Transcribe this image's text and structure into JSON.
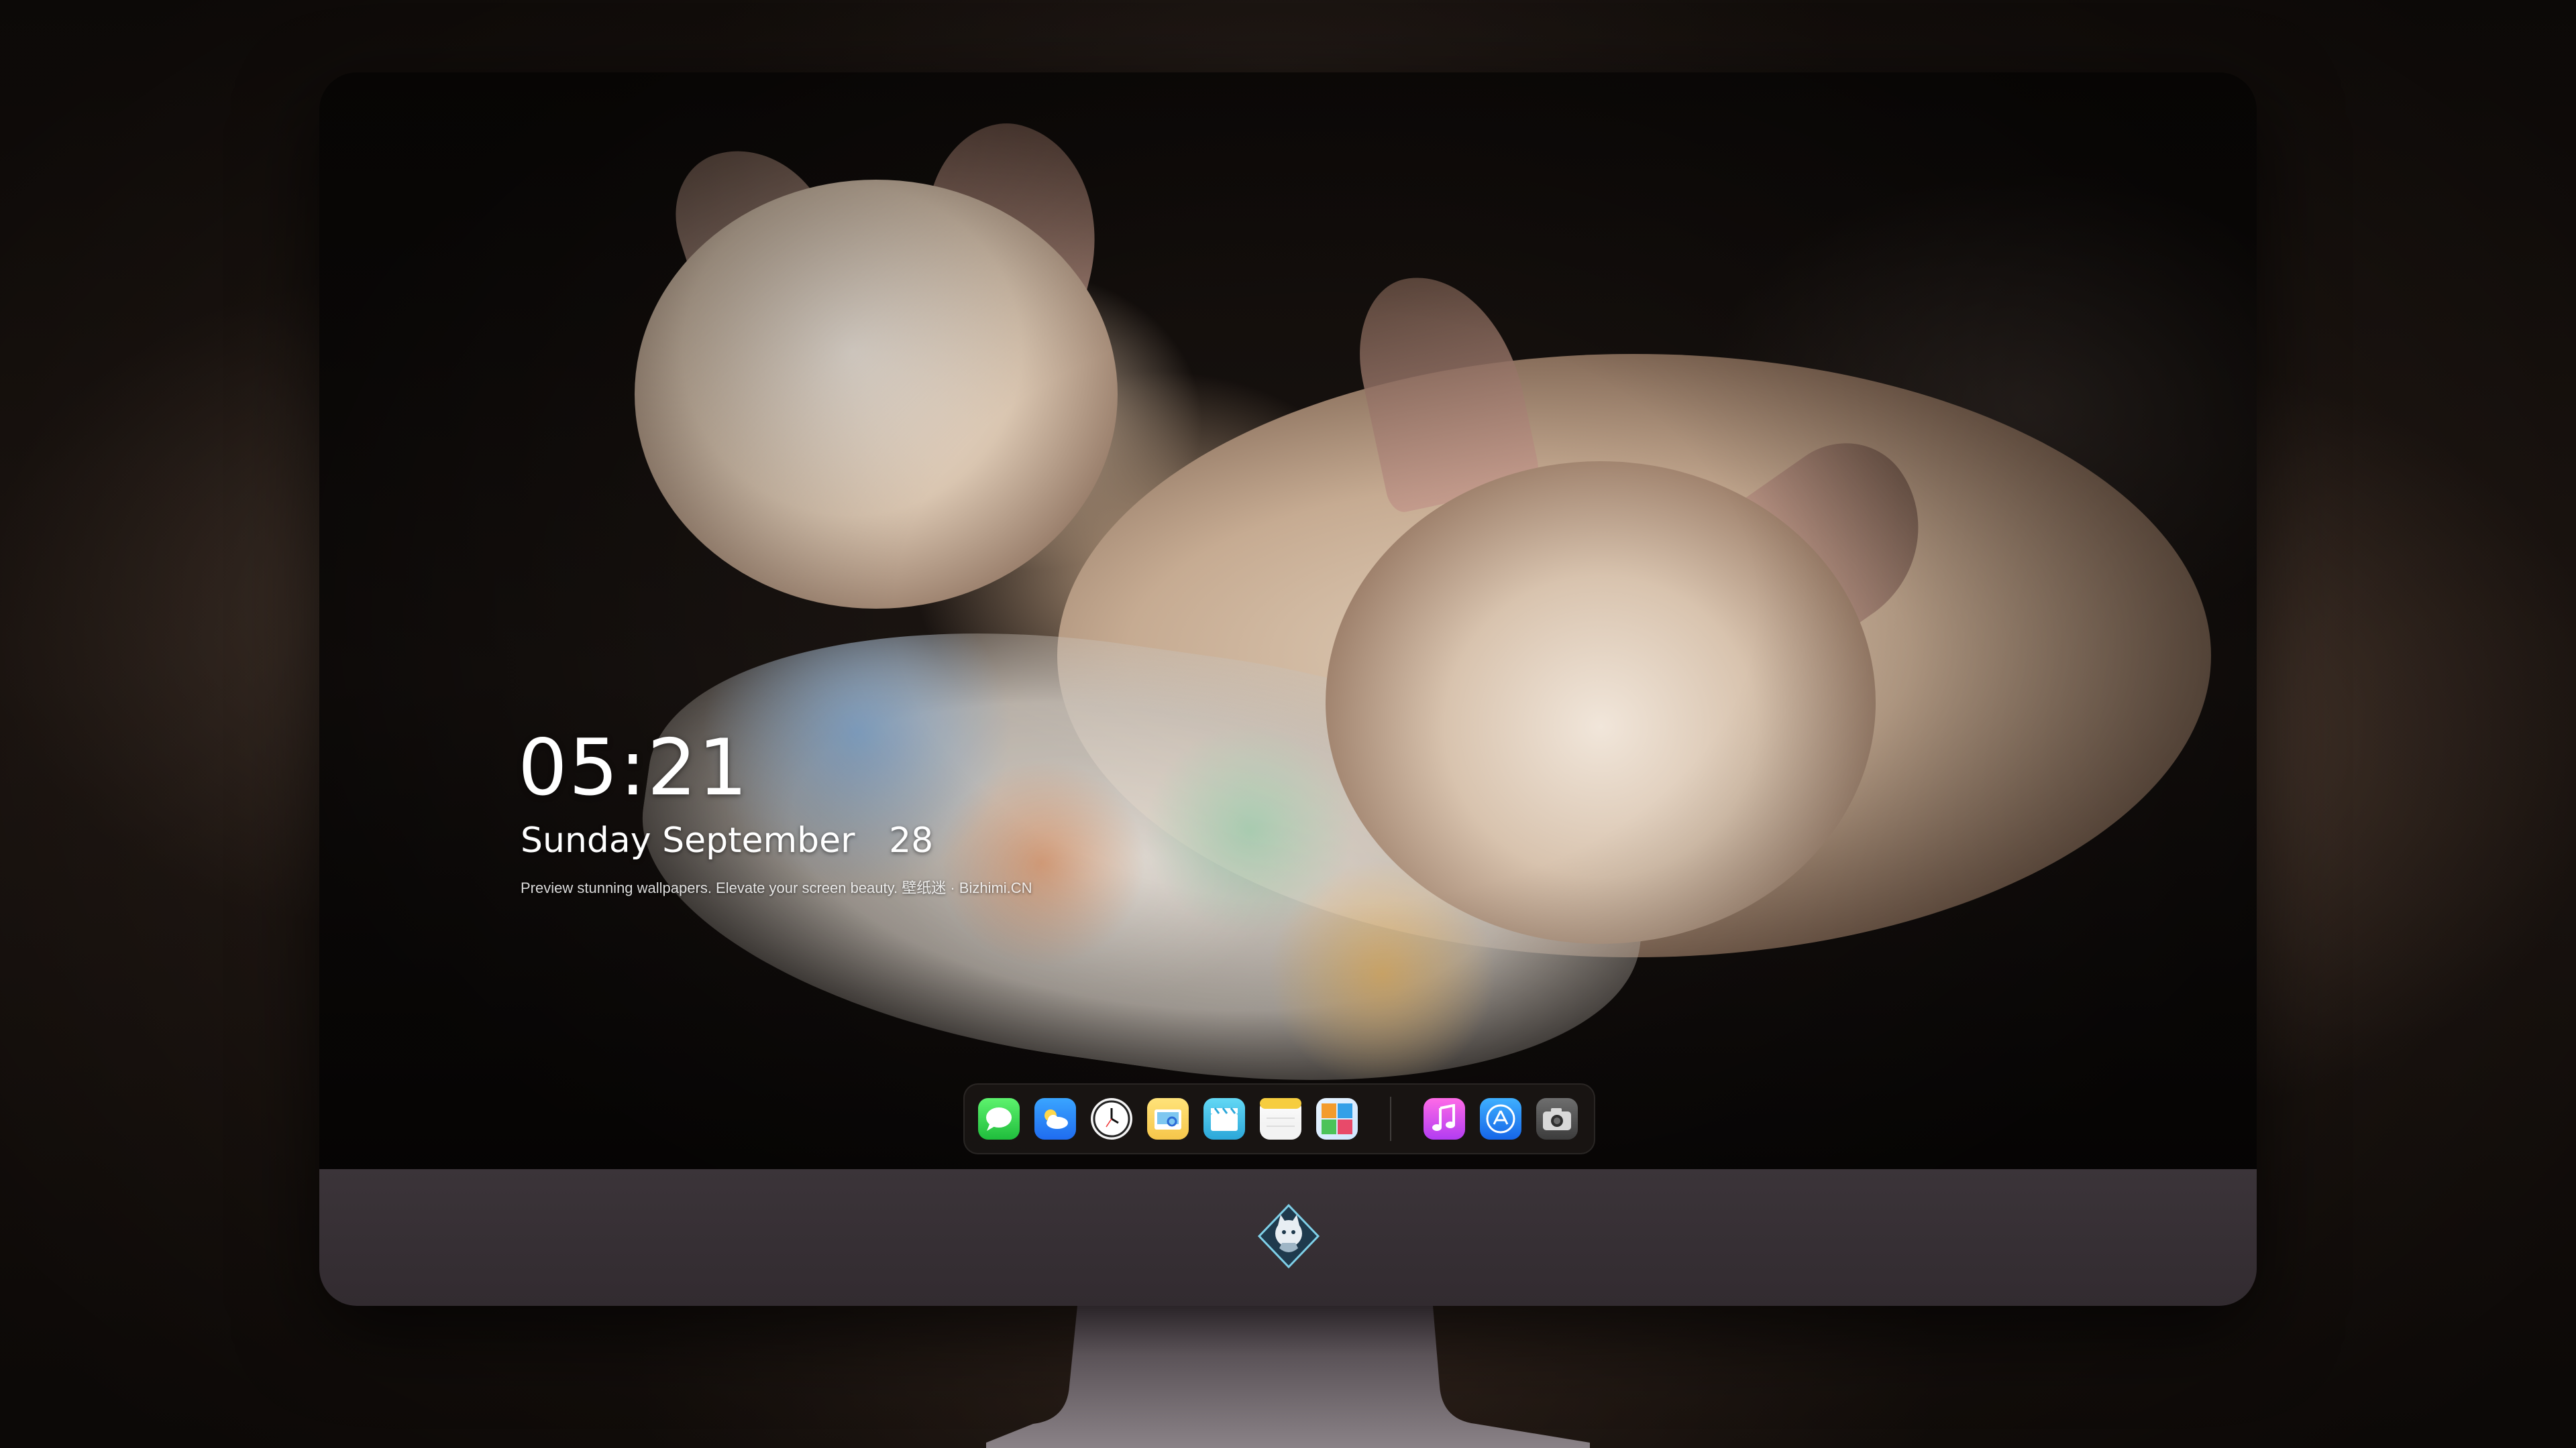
{
  "lock_screen": {
    "time": "05:21",
    "weekday": "Sunday",
    "month": "September",
    "day": "28",
    "tagline": "Preview stunning wallpapers. Elevate your screen beauty. 壁纸迷 · Bizhimi.CN"
  },
  "dock": {
    "apps": [
      {
        "name": "Messages",
        "icon": "messages-icon"
      },
      {
        "name": "Weather",
        "icon": "weather-icon"
      },
      {
        "name": "Clock",
        "icon": "clock-icon"
      },
      {
        "name": "Preview",
        "icon": "preview-icon"
      },
      {
        "name": "Clips",
        "icon": "clips-icon"
      },
      {
        "name": "Notes",
        "icon": "notes-icon"
      },
      {
        "name": "Photos",
        "icon": "photos-icon"
      },
      {
        "name": "Music",
        "icon": "music-icon"
      },
      {
        "name": "App Store",
        "icon": "app-store-icon"
      },
      {
        "name": "Camera",
        "icon": "camera-icon"
      }
    ]
  },
  "monitor": {
    "chin_logo": "bizhimi-mascot-logo"
  },
  "colors": {
    "chin": "#3b3439",
    "dock_bg": "#1c1816",
    "text": "#ffffff"
  }
}
